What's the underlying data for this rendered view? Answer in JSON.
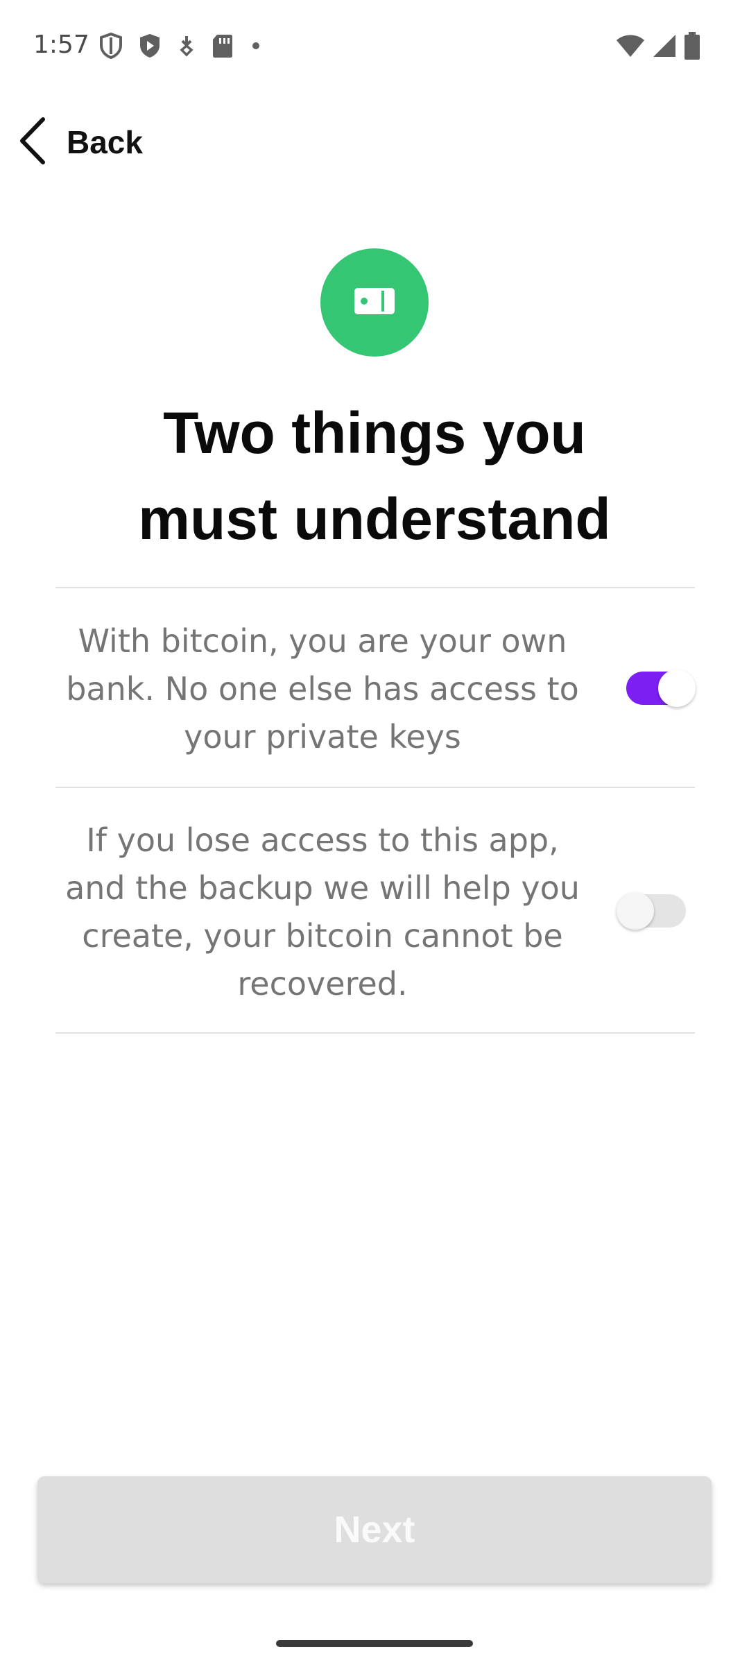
{
  "status_bar": {
    "time": "1:57",
    "left_icons": [
      "shield-outline-icon",
      "play-shield-icon",
      "download-notification-icon",
      "sd-card-icon",
      "dot-icon"
    ],
    "right_icons": [
      "wifi-icon",
      "signal-icon",
      "battery-icon"
    ]
  },
  "header": {
    "back_label": "Back"
  },
  "hero": {
    "icon": "wallet-card-icon",
    "color": "#34c672"
  },
  "title": {
    "line1": "Two things you",
    "line2": "must understand"
  },
  "items": [
    {
      "lines": [
        "With bitcoin, you are your own",
        "bank. No one else has access to",
        "your private keys"
      ],
      "checked": true
    },
    {
      "lines": [
        "If you lose access to this app,",
        "and the backup we will help you",
        "create, your bitcoin cannot be",
        "recovered."
      ],
      "checked": false
    }
  ],
  "footer": {
    "next_label": "Next",
    "next_enabled": false
  },
  "colors": {
    "accent": "#7b1ff2",
    "hero_green": "#34c672",
    "disabled_button": "#dedede"
  }
}
